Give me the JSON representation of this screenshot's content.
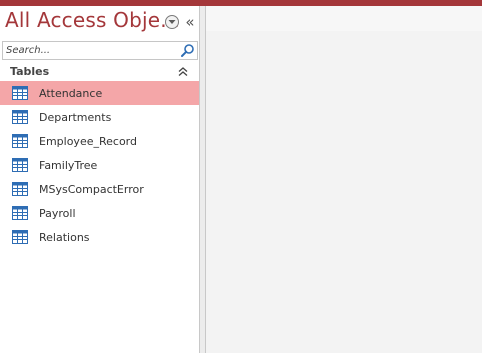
{
  "accent_color": "#a4373a",
  "selected_color": "#f4a6a8",
  "nav": {
    "title": "All Access Obje...",
    "menu_icon": "chevron-down-circle-icon",
    "collapse_glyph": "«",
    "search": {
      "placeholder": "Search...",
      "value": ""
    },
    "group": {
      "label": "Tables",
      "toggle_icon": "double-chevron-up-icon"
    },
    "items": [
      {
        "label": "Attendance",
        "selected": true
      },
      {
        "label": "Departments",
        "selected": false
      },
      {
        "label": "Employee_Record",
        "selected": false
      },
      {
        "label": "FamilyTree",
        "selected": false
      },
      {
        "label": "MSysCompactError",
        "selected": false
      },
      {
        "label": "Payroll",
        "selected": false
      },
      {
        "label": "Relations",
        "selected": false
      }
    ]
  }
}
